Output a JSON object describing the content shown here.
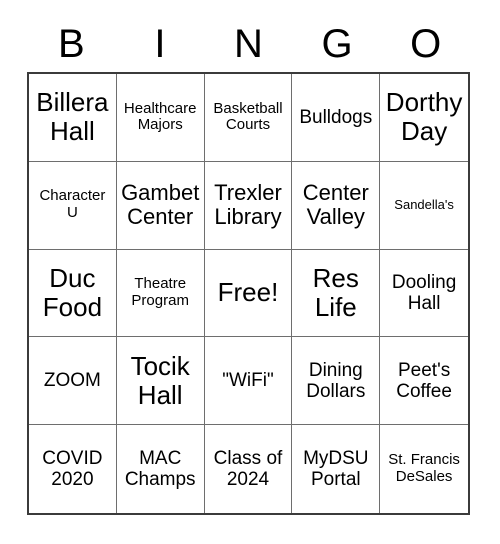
{
  "card": {
    "title": "BINGO",
    "header_letters": [
      "B",
      "I",
      "N",
      "G",
      "O"
    ],
    "colors": {
      "background": "#ffffff",
      "text": "#000000",
      "outer_border": "#3b3b3b",
      "inner_border": "#6e6e6e"
    },
    "grid": {
      "columns": 5,
      "rows": 5,
      "free_space": "Free!",
      "cells": [
        {
          "label": "Billera Hall",
          "size": "xl"
        },
        {
          "label": "Healthcare Majors",
          "size": "sm"
        },
        {
          "label": "Basketball Courts",
          "size": "sm"
        },
        {
          "label": "Bulldogs",
          "size": "md"
        },
        {
          "label": "Dorthy Day",
          "size": "xl"
        },
        {
          "label": "Character U",
          "size": "sm"
        },
        {
          "label": "Gambet Center",
          "size": "lg"
        },
        {
          "label": "Trexler Library",
          "size": "lg"
        },
        {
          "label": "Center Valley",
          "size": "lg"
        },
        {
          "label": "Sandella's",
          "size": "xs"
        },
        {
          "label": "Duc Food",
          "size": "xl"
        },
        {
          "label": "Theatre Program",
          "size": "sm"
        },
        {
          "label": "Free!",
          "size": "xl"
        },
        {
          "label": "Res Life",
          "size": "xl"
        },
        {
          "label": "Dooling Hall",
          "size": "md"
        },
        {
          "label": "ZOOM",
          "size": "md"
        },
        {
          "label": "Tocik Hall",
          "size": "xl"
        },
        {
          "label": "\"WiFi\"",
          "size": "md"
        },
        {
          "label": "Dining Dollars",
          "size": "md"
        },
        {
          "label": "Peet's Coffee",
          "size": "md"
        },
        {
          "label": "COVID 2020",
          "size": "md"
        },
        {
          "label": "MAC Champs",
          "size": "md"
        },
        {
          "label": "Class of 2024",
          "size": "md"
        },
        {
          "label": "MyDSU Portal",
          "size": "md"
        },
        {
          "label": "St. Francis DeSales",
          "size": "sm"
        }
      ]
    }
  }
}
